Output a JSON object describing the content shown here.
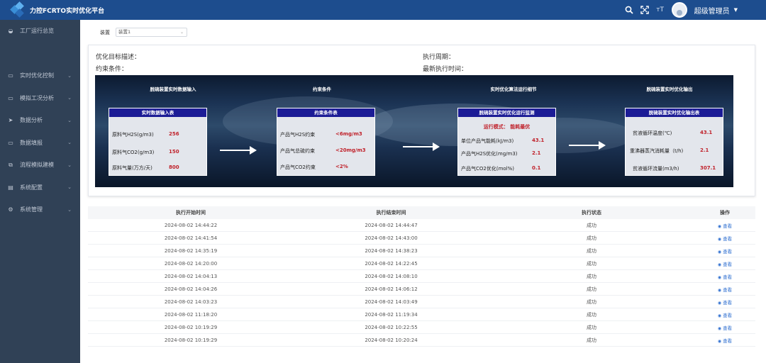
{
  "header": {
    "app_title": "力控FCRTO实时优化平台",
    "user_name": "超级管理员",
    "icons": [
      "search-icon",
      "fullscreen-icon",
      "font-size-icon"
    ]
  },
  "sidebar": {
    "items": [
      {
        "label": "工厂运行总览",
        "icon": "dashboard-icon",
        "has_children": false
      },
      {
        "label": "",
        "icon": "",
        "has_children": false,
        "active": true
      },
      {
        "label": "实时优化控制",
        "icon": "monitor-icon",
        "has_children": true
      },
      {
        "label": "模拟工况分析",
        "icon": "monitor-icon",
        "has_children": true
      },
      {
        "label": "数据分析",
        "icon": "send-icon",
        "has_children": true
      },
      {
        "label": "数据填报",
        "icon": "card-icon",
        "has_children": true
      },
      {
        "label": "流程模拟建模",
        "icon": "external-icon",
        "has_children": true
      },
      {
        "label": "系统配置",
        "icon": "document-icon",
        "has_children": true
      },
      {
        "label": "系统管理",
        "icon": "gear-icon",
        "has_children": true
      }
    ]
  },
  "filter": {
    "label": "装置",
    "value": "装置1"
  },
  "overview": {
    "objective_label": "优化目标描述：",
    "constraint_label": "约束条件：",
    "period_label": "执行周期：",
    "latest_time_label": "最新执行时间："
  },
  "diagram": {
    "stages": [
      {
        "title": "脱硫装置实时数据输入",
        "panel_title": "实时数据输入表",
        "rows": [
          {
            "label": "原料气H2S(g/m3)",
            "value": "256"
          },
          {
            "label": "原料气CO2(g/m3)",
            "value": "150"
          },
          {
            "label": "原料气量(万方/天)",
            "value": "800"
          }
        ]
      },
      {
        "title": "约束条件",
        "panel_title": "约束条件表",
        "rows": [
          {
            "label": "产品气H2S约束",
            "value": "<6mg/m3"
          },
          {
            "label": "产品气总硫约束",
            "value": "<20mg/m3"
          },
          {
            "label": "产品气CO2约束",
            "value": "<2%"
          }
        ]
      },
      {
        "title": "实时优化算法运行细节",
        "panel_title": "脱硫装置实时优化运行监测",
        "mode": "运行模式：  能耗最优",
        "rows": [
          {
            "label": "单位产品气能耗(kJ/m3)",
            "value": "43.1"
          },
          {
            "label": "产品气H2S优化(mg/m3)",
            "value": "2.1"
          },
          {
            "label": "产品气CO2优化(mol%)",
            "value": "0.1"
          }
        ]
      },
      {
        "title": "脱硫装置实时优化输出",
        "panel_title": "脱硫装置实时优化输出表",
        "rows": [
          {
            "label": "贫液循环温度(℃)",
            "value": "43.1"
          },
          {
            "label": "重沸器蒸汽消耗量（t/h)",
            "value": "2.1"
          },
          {
            "label": "贫液循环流量(m3/h)",
            "value": "307.1"
          }
        ]
      }
    ]
  },
  "table": {
    "headers": [
      "执行开始时间",
      "执行结束时间",
      "执行状态",
      "操作"
    ],
    "rows": [
      [
        "2024-08-02 14:44:22",
        "2024-08-02 14:44:47",
        "成功",
        "查看"
      ],
      [
        "2024-08-02 14:41:54",
        "2024-08-02 14:43:00",
        "成功",
        "查看"
      ],
      [
        "2024-08-02 14:35:19",
        "2024-08-02 14:38:23",
        "成功",
        "查看"
      ],
      [
        "2024-08-02 14:20:00",
        "2024-08-02 14:22:45",
        "成功",
        "查看"
      ],
      [
        "2024-08-02 14:04:13",
        "2024-08-02 14:08:10",
        "成功",
        "查看"
      ],
      [
        "2024-08-02 14:04:26",
        "2024-08-02 14:06:12",
        "成功",
        "查看"
      ],
      [
        "2024-08-02 14:03:23",
        "2024-08-02 14:03:49",
        "成功",
        "查看"
      ],
      [
        "2024-08-02 11:18:20",
        "2024-08-02 11:19:34",
        "成功",
        "查看"
      ],
      [
        "2024-08-02 10:19:29",
        "2024-08-02 10:22:55",
        "成功",
        "查看"
      ],
      [
        "2024-08-02 10:19:29",
        "2024-08-02 10:20:24",
        "成功",
        "查看"
      ]
    ]
  }
}
